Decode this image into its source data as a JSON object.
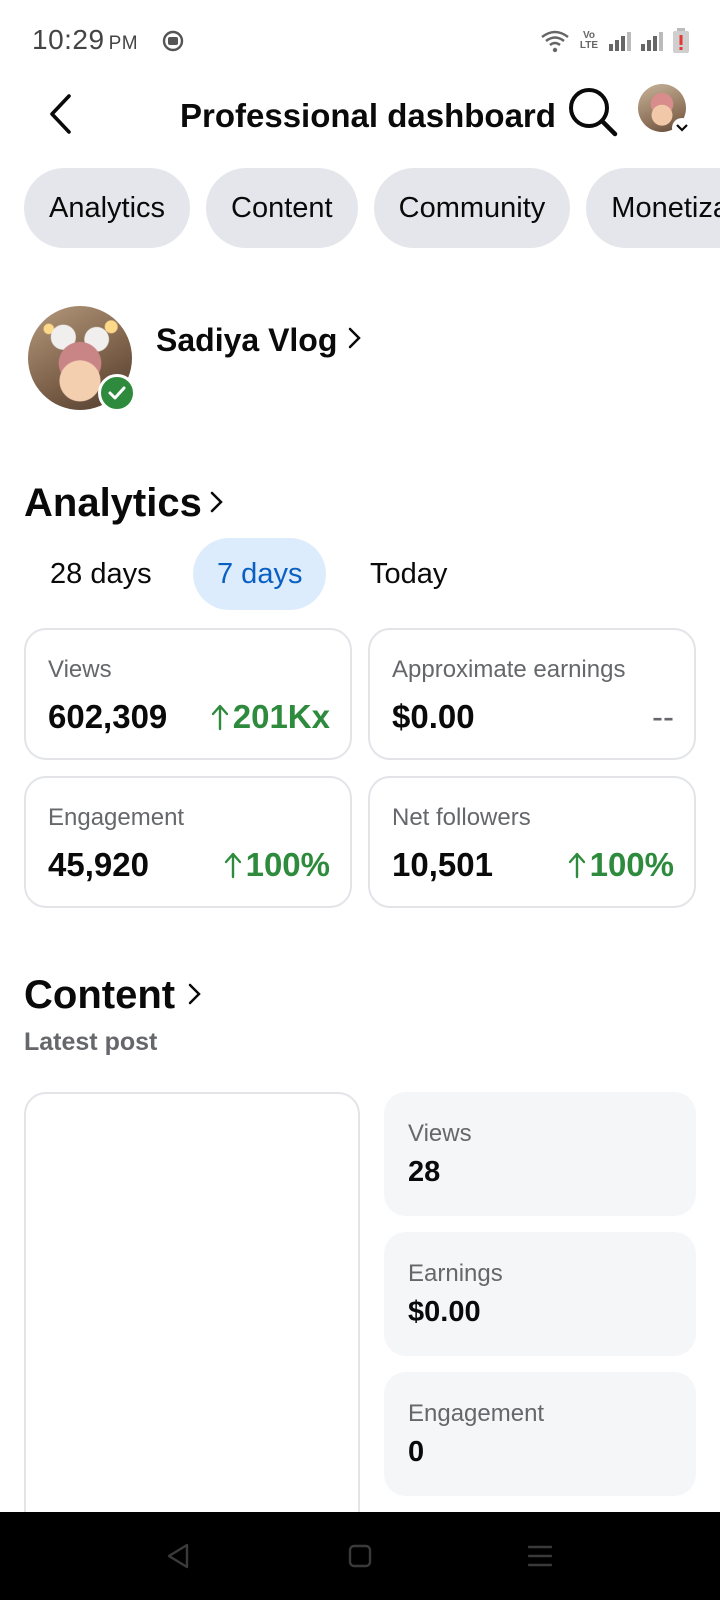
{
  "status_bar": {
    "time": "10:29",
    "ampm": "PM",
    "volte": "Vo LTE"
  },
  "header": {
    "title": "Professional dashboard"
  },
  "chips": [
    "Analytics",
    "Content",
    "Community",
    "Monetization"
  ],
  "profile": {
    "name": "Sadiya Vlog"
  },
  "analytics": {
    "heading": "Analytics",
    "ranges": [
      "28 days",
      "7 days",
      "Today"
    ],
    "selected_range": "7 days",
    "cards": [
      {
        "label": "Views",
        "value": "602,309",
        "delta": "201Kx"
      },
      {
        "label": "Approximate earnings",
        "value": "$0.00",
        "delta": "--"
      },
      {
        "label": "Engagement",
        "value": "45,920",
        "delta": "100%"
      },
      {
        "label": "Net followers",
        "value": "10,501",
        "delta": "100%"
      }
    ]
  },
  "content": {
    "heading": "Content",
    "subheading": "Latest post",
    "metrics": [
      {
        "label": "Views",
        "value": "28"
      },
      {
        "label": "Earnings",
        "value": "$0.00"
      },
      {
        "label": "Engagement",
        "value": "0"
      }
    ]
  },
  "colors": {
    "positive": "#2e8b3d",
    "accent_blue": "#0a5fc2",
    "chip_bg": "#e4e6eb"
  }
}
